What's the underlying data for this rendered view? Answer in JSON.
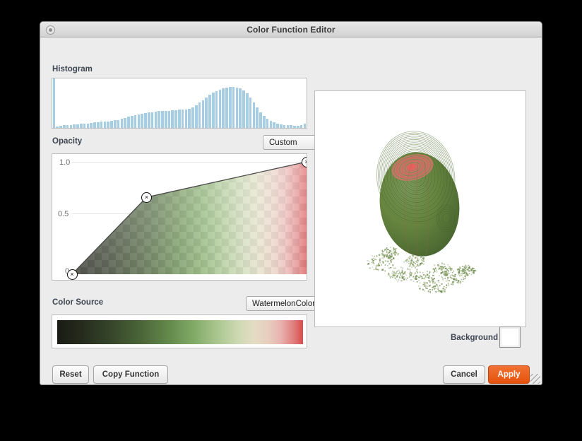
{
  "window": {
    "title": "Color Function Editor",
    "window_button_icon": "window-control-icon"
  },
  "histogram": {
    "label": "Histogram",
    "bar_color": "#a6cde2",
    "values": [
      98,
      3,
      4,
      5,
      5,
      6,
      7,
      7,
      8,
      9,
      9,
      10,
      11,
      11,
      12,
      13,
      13,
      14,
      15,
      16,
      18,
      20,
      22,
      24,
      25,
      27,
      28,
      30,
      31,
      31,
      32,
      33,
      33,
      34,
      34,
      35,
      35,
      36,
      36,
      37,
      38,
      40,
      45,
      50,
      55,
      60,
      66,
      70,
      73,
      76,
      78,
      80,
      81,
      81,
      80,
      78,
      74,
      68,
      60,
      50,
      40,
      31,
      24,
      18,
      14,
      11,
      9,
      7,
      6,
      5,
      5,
      4,
      4,
      5,
      9
    ]
  },
  "opacity": {
    "label": "Opacity",
    "preset": "Custom",
    "axis_labels": {
      "max": "1.0",
      "mid": "0.5",
      "min": "0"
    },
    "control_points": [
      {
        "x": 0.0,
        "y": 0.0
      },
      {
        "x": 0.318,
        "y": 0.685
      },
      {
        "x": 1.0,
        "y": 1.0
      }
    ],
    "point_icon": "control-point-x-icon"
  },
  "color_source": {
    "label": "Color Source",
    "preset": "WatermelonColors",
    "ramp_stops": [
      {
        "pos": 0.0,
        "color": "#1a1c15"
      },
      {
        "pos": 0.1,
        "color": "#252b1c"
      },
      {
        "pos": 0.22,
        "color": "#36462a"
      },
      {
        "pos": 0.34,
        "color": "#4a6538"
      },
      {
        "pos": 0.46,
        "color": "#658b4c"
      },
      {
        "pos": 0.56,
        "color": "#83ac68"
      },
      {
        "pos": 0.66,
        "color": "#adc993"
      },
      {
        "pos": 0.74,
        "color": "#cfd9b4"
      },
      {
        "pos": 0.8,
        "color": "#e3dcc3"
      },
      {
        "pos": 0.86,
        "color": "#e8cdbe"
      },
      {
        "pos": 0.91,
        "color": "#e9b2ae"
      },
      {
        "pos": 0.96,
        "color": "#e08080"
      },
      {
        "pos": 1.0,
        "color": "#d94b4b"
      }
    ]
  },
  "render": {
    "background_label": "Background",
    "background_color": "#ffffff",
    "object_color": "#5f7f40",
    "object_highlight_color": "#d9736b",
    "speck_color": "#6f8a4e"
  },
  "buttons": {
    "reset": "Reset",
    "copy_function": "Copy Function",
    "cancel": "Cancel",
    "apply": "Apply",
    "apply_color": "#e6520d"
  },
  "grip": {
    "icon": "resize-grip-icon"
  }
}
